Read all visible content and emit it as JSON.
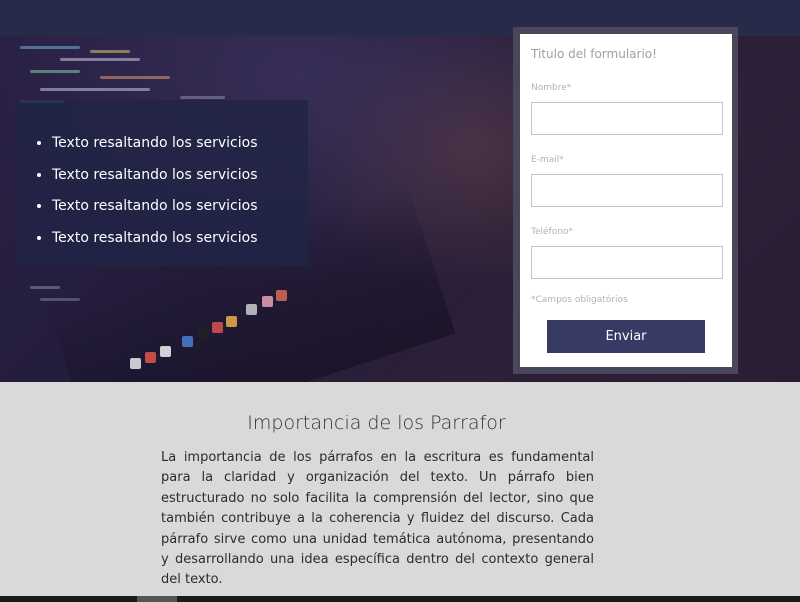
{
  "hero": {
    "features": [
      "Texto resaltando los servicios",
      "Texto resaltando los servicios",
      "Texto resaltando los servicios",
      "Texto resaltando los servicios"
    ]
  },
  "form": {
    "title": "Titulo del formulario!",
    "fields": [
      {
        "label": "Nombre*",
        "value": ""
      },
      {
        "label": "E-mail*",
        "value": ""
      },
      {
        "label": "Teléfono*",
        "value": ""
      }
    ],
    "required_note": "*Campos obligatórios",
    "submit_label": "Enviar"
  },
  "section": {
    "title": "Importancia de los Parrafor",
    "body": "La importancia de los párrafos en la escritura es fundamental para la claridad y organización del texto. Un párrafo bien estructurado no solo facilita la comprensión del lector, sino que también contribuye a la coherencia y fluidez del discurso. Cada párrafo sirve como una unidad temática autónoma, presentando y desarrollando una idea específica dentro del contexto general del texto."
  },
  "colors": {
    "topbar": "#272a48",
    "button": "#383a66",
    "section_bg": "#d9d9d9"
  }
}
